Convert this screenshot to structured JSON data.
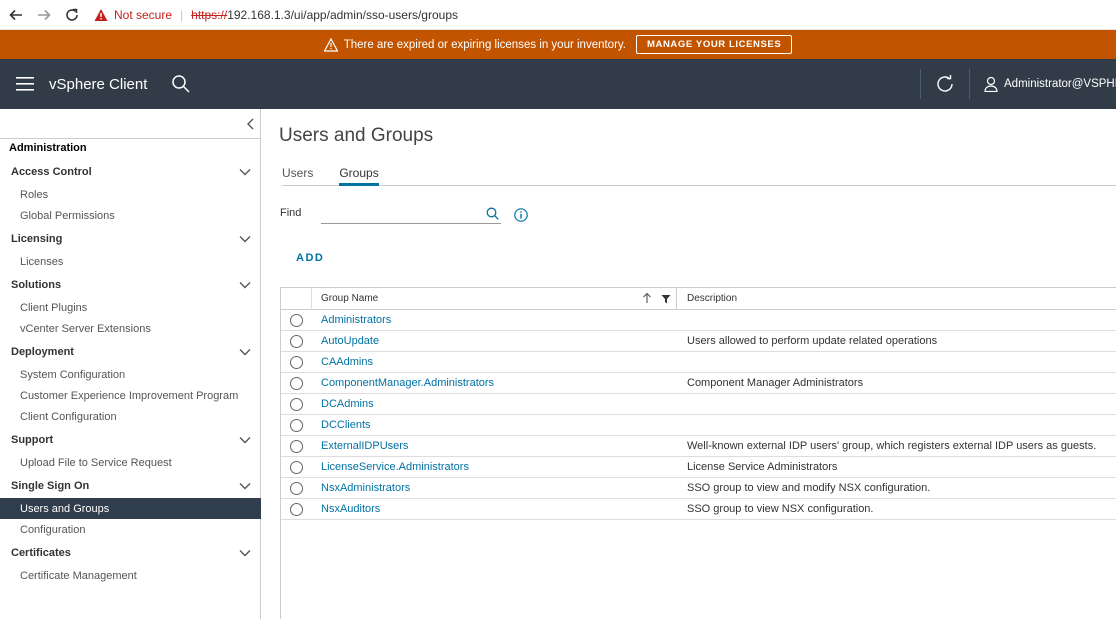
{
  "browser": {
    "not_secure": "Not secure",
    "url_scheme": "https://",
    "url_rest": "192.168.1.3/ui/app/admin/sso-users/groups"
  },
  "banner": {
    "message": "There are expired or expiring licenses in your inventory.",
    "button": "MANAGE YOUR LICENSES",
    "color": "#c25400"
  },
  "header": {
    "title": "vSphere Client",
    "user": "Administrator@VSPHERE.LOCAL",
    "color": "#313c48"
  },
  "sidebar": {
    "heading": "Administration",
    "sections": [
      {
        "label": "Access Control",
        "items": [
          "Roles",
          "Global Permissions"
        ]
      },
      {
        "label": "Licensing",
        "items": [
          "Licenses"
        ]
      },
      {
        "label": "Solutions",
        "items": [
          "Client Plugins",
          "vCenter Server Extensions"
        ]
      },
      {
        "label": "Deployment",
        "items": [
          "System Configuration",
          "Customer Experience Improvement Program",
          "Client Configuration"
        ]
      },
      {
        "label": "Support",
        "items": [
          "Upload File to Service Request"
        ]
      },
      {
        "label": "Single Sign On",
        "items": [
          "Users and Groups",
          "Configuration"
        ]
      },
      {
        "label": "Certificates",
        "items": [
          "Certificate Management"
        ]
      }
    ],
    "active_item": "Users and Groups"
  },
  "main": {
    "title": "Users and Groups",
    "tabs": [
      "Users",
      "Groups"
    ],
    "active_tab": "Groups",
    "find_label": "Find",
    "find_value": "",
    "add_label": "ADD",
    "columns": [
      "Group Name",
      "Description"
    ],
    "rows": [
      {
        "name": "Administrators",
        "desc": ""
      },
      {
        "name": "AutoUpdate",
        "desc": "Users allowed to perform update related operations"
      },
      {
        "name": "CAAdmins",
        "desc": ""
      },
      {
        "name": "ComponentManager.Administrators",
        "desc": "Component Manager Administrators"
      },
      {
        "name": "DCAdmins",
        "desc": ""
      },
      {
        "name": "DCClients",
        "desc": ""
      },
      {
        "name": "ExternalIDPUsers",
        "desc": "Well-known external IDP users' group, which registers external IDP users as guests."
      },
      {
        "name": "LicenseService.Administrators",
        "desc": "License Service Administrators"
      },
      {
        "name": "NsxAdministrators",
        "desc": "SSO group to view and modify NSX configuration."
      },
      {
        "name": "NsxAuditors",
        "desc": "SSO group to view NSX configuration."
      }
    ],
    "link_color": "#0072a3"
  }
}
